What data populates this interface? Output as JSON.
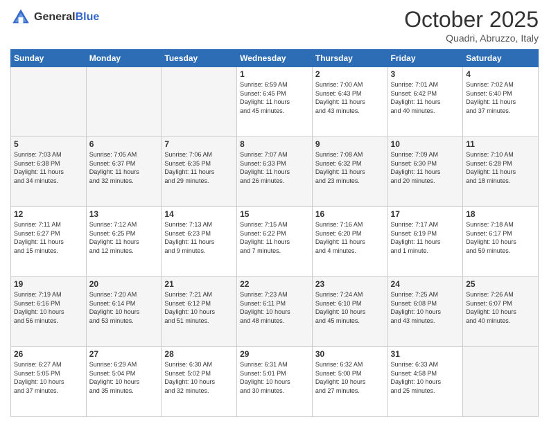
{
  "header": {
    "logo_general": "General",
    "logo_blue": "Blue",
    "month_title": "October 2025",
    "location": "Quadri, Abruzzo, Italy"
  },
  "weekdays": [
    "Sunday",
    "Monday",
    "Tuesday",
    "Wednesday",
    "Thursday",
    "Friday",
    "Saturday"
  ],
  "weeks": [
    [
      {
        "day": "",
        "info": ""
      },
      {
        "day": "",
        "info": ""
      },
      {
        "day": "",
        "info": ""
      },
      {
        "day": "1",
        "info": "Sunrise: 6:59 AM\nSunset: 6:45 PM\nDaylight: 11 hours\nand 45 minutes."
      },
      {
        "day": "2",
        "info": "Sunrise: 7:00 AM\nSunset: 6:43 PM\nDaylight: 11 hours\nand 43 minutes."
      },
      {
        "day": "3",
        "info": "Sunrise: 7:01 AM\nSunset: 6:42 PM\nDaylight: 11 hours\nand 40 minutes."
      },
      {
        "day": "4",
        "info": "Sunrise: 7:02 AM\nSunset: 6:40 PM\nDaylight: 11 hours\nand 37 minutes."
      }
    ],
    [
      {
        "day": "5",
        "info": "Sunrise: 7:03 AM\nSunset: 6:38 PM\nDaylight: 11 hours\nand 34 minutes."
      },
      {
        "day": "6",
        "info": "Sunrise: 7:05 AM\nSunset: 6:37 PM\nDaylight: 11 hours\nand 32 minutes."
      },
      {
        "day": "7",
        "info": "Sunrise: 7:06 AM\nSunset: 6:35 PM\nDaylight: 11 hours\nand 29 minutes."
      },
      {
        "day": "8",
        "info": "Sunrise: 7:07 AM\nSunset: 6:33 PM\nDaylight: 11 hours\nand 26 minutes."
      },
      {
        "day": "9",
        "info": "Sunrise: 7:08 AM\nSunset: 6:32 PM\nDaylight: 11 hours\nand 23 minutes."
      },
      {
        "day": "10",
        "info": "Sunrise: 7:09 AM\nSunset: 6:30 PM\nDaylight: 11 hours\nand 20 minutes."
      },
      {
        "day": "11",
        "info": "Sunrise: 7:10 AM\nSunset: 6:28 PM\nDaylight: 11 hours\nand 18 minutes."
      }
    ],
    [
      {
        "day": "12",
        "info": "Sunrise: 7:11 AM\nSunset: 6:27 PM\nDaylight: 11 hours\nand 15 minutes."
      },
      {
        "day": "13",
        "info": "Sunrise: 7:12 AM\nSunset: 6:25 PM\nDaylight: 11 hours\nand 12 minutes."
      },
      {
        "day": "14",
        "info": "Sunrise: 7:13 AM\nSunset: 6:23 PM\nDaylight: 11 hours\nand 9 minutes."
      },
      {
        "day": "15",
        "info": "Sunrise: 7:15 AM\nSunset: 6:22 PM\nDaylight: 11 hours\nand 7 minutes."
      },
      {
        "day": "16",
        "info": "Sunrise: 7:16 AM\nSunset: 6:20 PM\nDaylight: 11 hours\nand 4 minutes."
      },
      {
        "day": "17",
        "info": "Sunrise: 7:17 AM\nSunset: 6:19 PM\nDaylight: 11 hours\nand 1 minute."
      },
      {
        "day": "18",
        "info": "Sunrise: 7:18 AM\nSunset: 6:17 PM\nDaylight: 10 hours\nand 59 minutes."
      }
    ],
    [
      {
        "day": "19",
        "info": "Sunrise: 7:19 AM\nSunset: 6:16 PM\nDaylight: 10 hours\nand 56 minutes."
      },
      {
        "day": "20",
        "info": "Sunrise: 7:20 AM\nSunset: 6:14 PM\nDaylight: 10 hours\nand 53 minutes."
      },
      {
        "day": "21",
        "info": "Sunrise: 7:21 AM\nSunset: 6:12 PM\nDaylight: 10 hours\nand 51 minutes."
      },
      {
        "day": "22",
        "info": "Sunrise: 7:23 AM\nSunset: 6:11 PM\nDaylight: 10 hours\nand 48 minutes."
      },
      {
        "day": "23",
        "info": "Sunrise: 7:24 AM\nSunset: 6:10 PM\nDaylight: 10 hours\nand 45 minutes."
      },
      {
        "day": "24",
        "info": "Sunrise: 7:25 AM\nSunset: 6:08 PM\nDaylight: 10 hours\nand 43 minutes."
      },
      {
        "day": "25",
        "info": "Sunrise: 7:26 AM\nSunset: 6:07 PM\nDaylight: 10 hours\nand 40 minutes."
      }
    ],
    [
      {
        "day": "26",
        "info": "Sunrise: 6:27 AM\nSunset: 5:05 PM\nDaylight: 10 hours\nand 37 minutes."
      },
      {
        "day": "27",
        "info": "Sunrise: 6:29 AM\nSunset: 5:04 PM\nDaylight: 10 hours\nand 35 minutes."
      },
      {
        "day": "28",
        "info": "Sunrise: 6:30 AM\nSunset: 5:02 PM\nDaylight: 10 hours\nand 32 minutes."
      },
      {
        "day": "29",
        "info": "Sunrise: 6:31 AM\nSunset: 5:01 PM\nDaylight: 10 hours\nand 30 minutes."
      },
      {
        "day": "30",
        "info": "Sunrise: 6:32 AM\nSunset: 5:00 PM\nDaylight: 10 hours\nand 27 minutes."
      },
      {
        "day": "31",
        "info": "Sunrise: 6:33 AM\nSunset: 4:58 PM\nDaylight: 10 hours\nand 25 minutes."
      },
      {
        "day": "",
        "info": ""
      }
    ]
  ]
}
